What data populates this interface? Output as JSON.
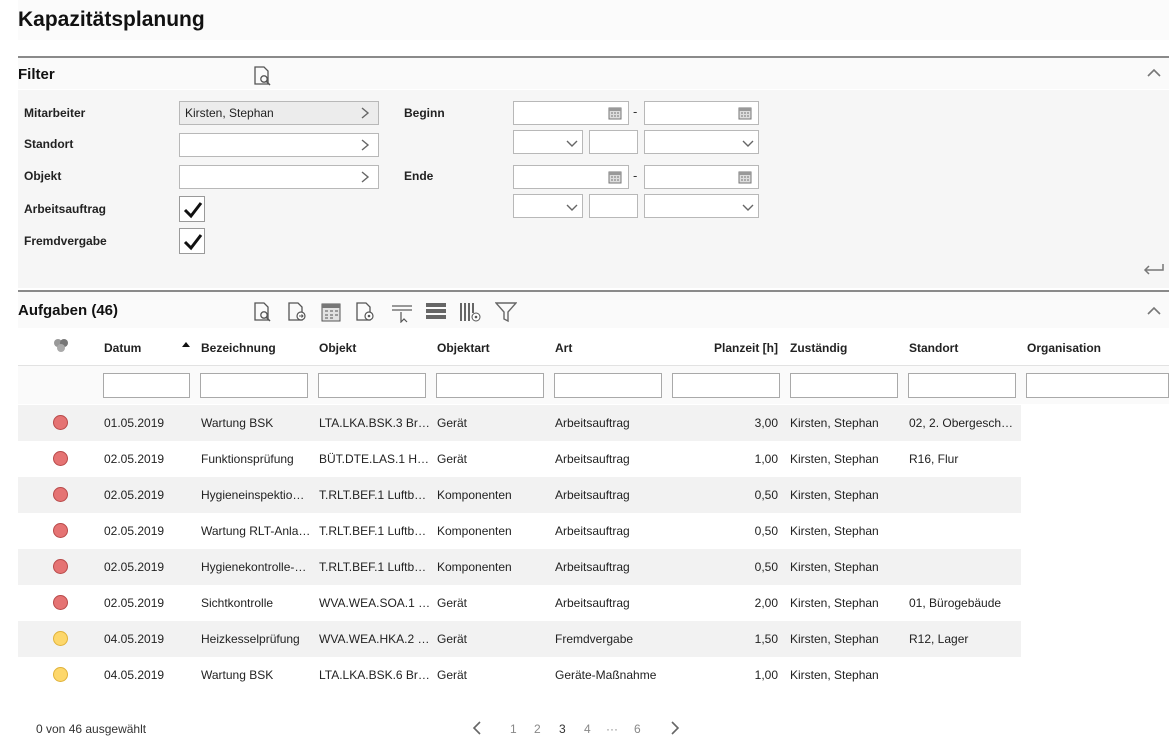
{
  "page": {
    "title": "Kapazitätsplanung"
  },
  "filter": {
    "header": "Filter",
    "labels": {
      "mitarbeiter": "Mitarbeiter",
      "standort": "Standort",
      "objekt": "Objekt",
      "arbeitsauftrag": "Arbeitsauftrag",
      "fremdvergabe": "Fremdvergabe",
      "beginn": "Beginn",
      "ende": "Ende"
    },
    "values": {
      "mitarbeiter": "Kirsten, Stephan",
      "standort": "",
      "objekt": "",
      "arbeitsauftrag_checked": true,
      "fremdvergabe_checked": true
    },
    "range_separator": "-"
  },
  "tasks": {
    "header": "Aufgaben (46)",
    "columns": [
      "Datum",
      "Bezeichnung",
      "Objekt",
      "Objektart",
      "Art",
      "Planzeit [h]",
      "Zuständig",
      "Standort",
      "Organisation"
    ],
    "rows": [
      {
        "status": "red",
        "datum": "01.05.2019",
        "bezeichnung": "Wartung BSK",
        "objekt": "LTA.LKA.BSK.3 Br…",
        "objektart": "Gerät",
        "art": "Arbeitsauftrag",
        "planzeit": "3,00",
        "zustaendig": "Kirsten, Stephan",
        "standort": "02, 2. Obergesch…",
        "organisation": ""
      },
      {
        "status": "red",
        "datum": "02.05.2019",
        "bezeichnung": "Funktionsprüfung",
        "objekt": "BÜT.DTE.LAS.1 H…",
        "objektart": "Gerät",
        "art": "Arbeitsauftrag",
        "planzeit": "1,00",
        "zustaendig": "Kirsten, Stephan",
        "standort": "R16, Flur",
        "organisation": ""
      },
      {
        "status": "red",
        "datum": "02.05.2019",
        "bezeichnung": "Hygieneinspektio…",
        "objekt": "T.RLT.BEF.1 Luftb…",
        "objektart": "Komponenten",
        "art": "Arbeitsauftrag",
        "planzeit": "0,50",
        "zustaendig": "Kirsten, Stephan",
        "standort": "",
        "organisation": ""
      },
      {
        "status": "red",
        "datum": "02.05.2019",
        "bezeichnung": "Wartung RLT-Anla…",
        "objekt": "T.RLT.BEF.1 Luftb…",
        "objektart": "Komponenten",
        "art": "Arbeitsauftrag",
        "planzeit": "0,50",
        "zustaendig": "Kirsten, Stephan",
        "standort": "",
        "organisation": ""
      },
      {
        "status": "red",
        "datum": "02.05.2019",
        "bezeichnung": "Hygienekontrolle-…",
        "objekt": "T.RLT.BEF.1 Luftb…",
        "objektart": "Komponenten",
        "art": "Arbeitsauftrag",
        "planzeit": "0,50",
        "zustaendig": "Kirsten, Stephan",
        "standort": "",
        "organisation": ""
      },
      {
        "status": "red",
        "datum": "02.05.2019",
        "bezeichnung": "Sichtkontrolle",
        "objekt": "WVA.WEA.SOA.1 …",
        "objektart": "Gerät",
        "art": "Arbeitsauftrag",
        "planzeit": "2,00",
        "zustaendig": "Kirsten, Stephan",
        "standort": "01, Bürogebäude",
        "organisation": ""
      },
      {
        "status": "yellow",
        "datum": "04.05.2019",
        "bezeichnung": "Heizkesselprüfung",
        "objekt": "WVA.WEA.HKA.2 …",
        "objektart": "Gerät",
        "art": "Fremdvergabe",
        "planzeit": "1,50",
        "zustaendig": "Kirsten, Stephan",
        "standort": "R12, Lager",
        "organisation": ""
      },
      {
        "status": "yellow",
        "datum": "04.05.2019",
        "bezeichnung": "Wartung BSK",
        "objekt": "LTA.LKA.BSK.6 Br…",
        "objektart": "Gerät",
        "art": "Geräte-Maßnahme",
        "planzeit": "1,00",
        "zustaendig": "Kirsten, Stephan",
        "standort": "",
        "organisation": ""
      }
    ],
    "selection_text": "0 von 46 ausgewählt",
    "pagination": [
      "1",
      "2",
      "3",
      "4",
      "···",
      "6"
    ],
    "current_page": "3"
  },
  "colors": {
    "status_red": "#e57373",
    "status_yellow": "#fdd76b",
    "row_stripe": "#f2f2f2"
  }
}
